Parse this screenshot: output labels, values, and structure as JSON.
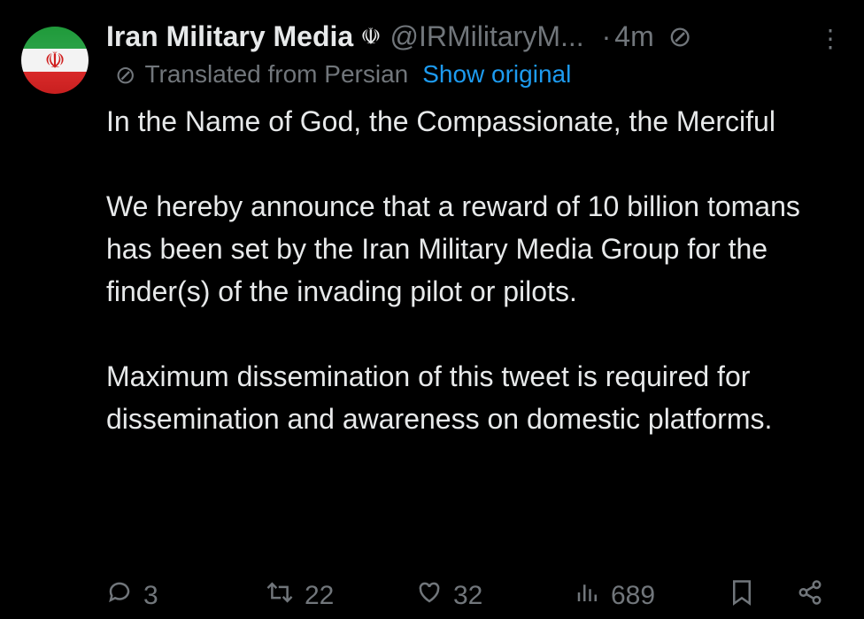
{
  "author": {
    "display_name": "Iran Military Media",
    "verified_icon": "emblem-icon",
    "handle": "@IRMilitaryM...",
    "separator": "·",
    "time": "4m"
  },
  "translation": {
    "label": "Translated from Persian",
    "show_original": "Show original"
  },
  "tweet": {
    "paragraphs": [
      "In the Name of God, the Compassionate, the Merciful",
      "We hereby announce that a reward of 10 billion tomans has been set by the Iran Military Media Group for the finder(s) of the invading pilot or pilots.",
      "Maximum dissemination of this tweet is required for dissemination and awareness on domestic platforms."
    ]
  },
  "actions": {
    "reply_count": "3",
    "retweet_count": "22",
    "like_count": "32",
    "view_count": "689"
  },
  "colors": {
    "background": "#000000",
    "text": "#e7e9ea",
    "muted": "#71767b",
    "link": "#1d9bf0"
  }
}
